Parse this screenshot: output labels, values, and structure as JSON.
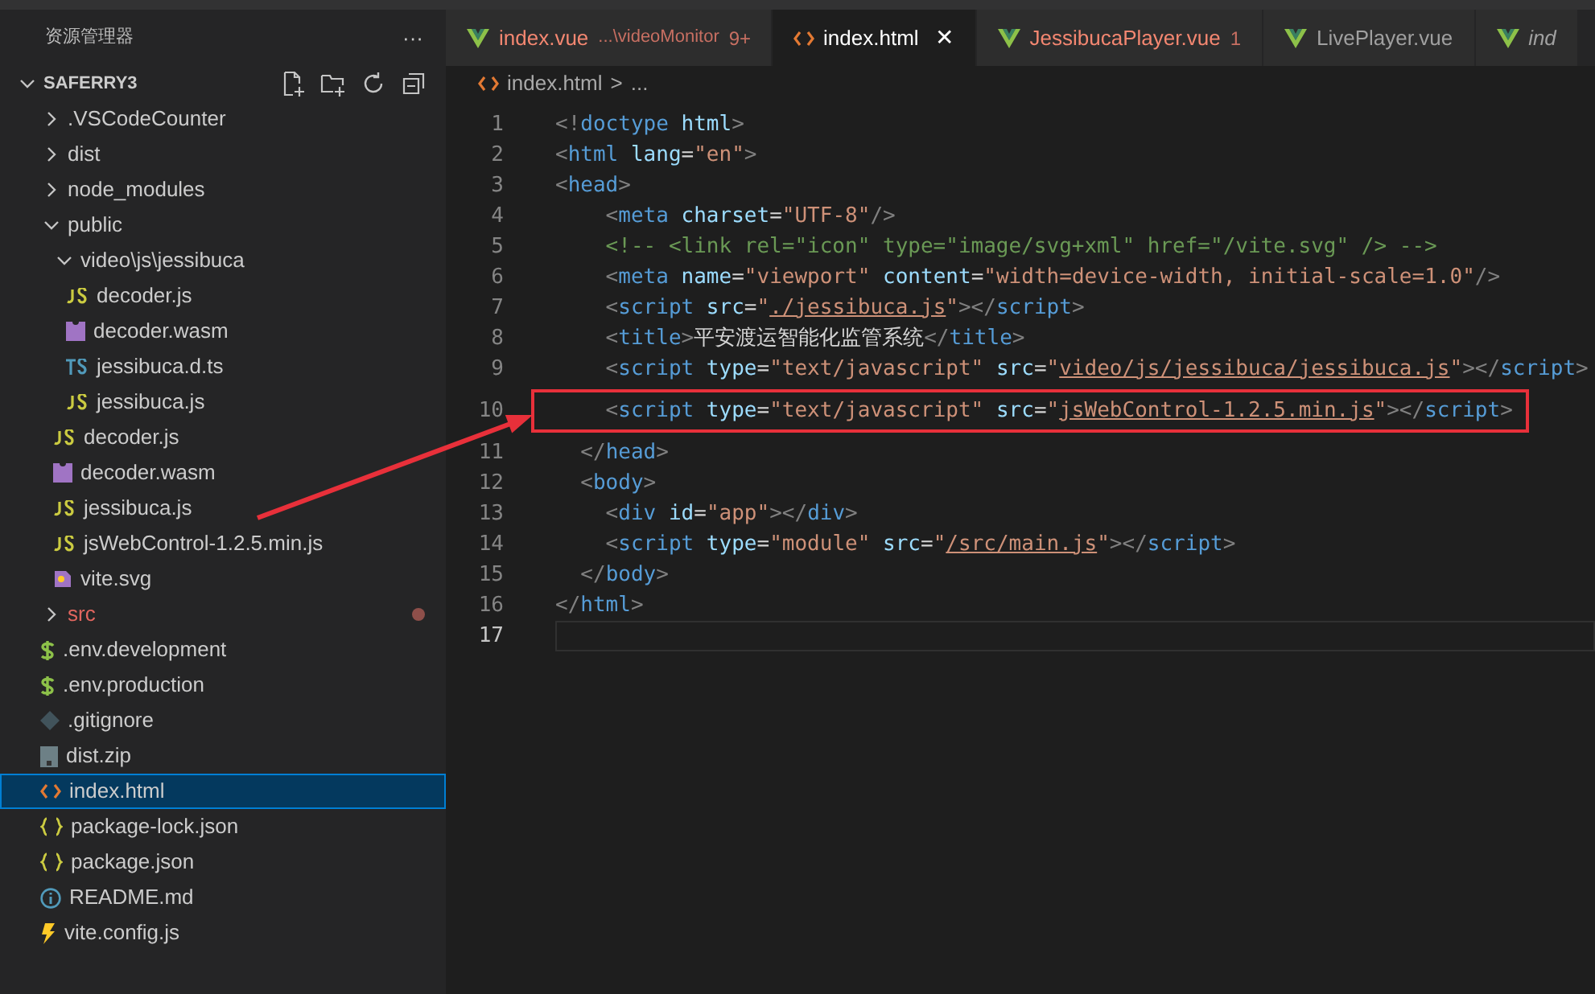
{
  "sidebar": {
    "title": "资源管理器",
    "more": "···",
    "project": {
      "name": "SAFERRY3",
      "expanded": true
    },
    "items": [
      {
        "label": ".VSCodeCounter",
        "kind": "folder",
        "expanded": false,
        "selected": false,
        "modified": false
      },
      {
        "label": "dist",
        "kind": "folder",
        "expanded": false,
        "selected": false,
        "modified": false
      },
      {
        "label": "node_modules",
        "kind": "folder",
        "expanded": false,
        "selected": false,
        "modified": false
      },
      {
        "label": "public",
        "kind": "folder",
        "expanded": true,
        "selected": false,
        "modified": false,
        "children": [
          {
            "label": "video\\js\\jessibuca",
            "kind": "folder",
            "expanded": true,
            "selected": false,
            "modified": false,
            "children": [
              {
                "label": "decoder.js",
                "kind": "js",
                "selected": false,
                "modified": false
              },
              {
                "label": "decoder.wasm",
                "kind": "wasm",
                "selected": false,
                "modified": false
              },
              {
                "label": "jessibuca.d.ts",
                "kind": "ts",
                "selected": false,
                "modified": false
              },
              {
                "label": "jessibuca.js",
                "kind": "js",
                "selected": false,
                "modified": false
              }
            ]
          },
          {
            "label": "decoder.js",
            "kind": "js",
            "selected": false,
            "modified": false
          },
          {
            "label": "decoder.wasm",
            "kind": "wasm",
            "selected": false,
            "modified": false
          },
          {
            "label": "jessibuca.js",
            "kind": "js",
            "selected": false,
            "modified": false
          },
          {
            "label": "jsWebControl-1.2.5.min.js",
            "kind": "js",
            "selected": false,
            "modified": false
          },
          {
            "label": "vite.svg",
            "kind": "svg",
            "selected": false,
            "modified": false
          }
        ]
      },
      {
        "label": "src",
        "kind": "folder",
        "expanded": false,
        "selected": false,
        "modified": true
      },
      {
        "label": ".env.development",
        "kind": "env",
        "selected": false,
        "modified": false
      },
      {
        "label": ".env.production",
        "kind": "env",
        "selected": false,
        "modified": false
      },
      {
        "label": ".gitignore",
        "kind": "git",
        "selected": false,
        "modified": false
      },
      {
        "label": "dist.zip",
        "kind": "zip",
        "selected": false,
        "modified": false
      },
      {
        "label": "index.html",
        "kind": "html",
        "selected": true,
        "modified": false
      },
      {
        "label": "package-lock.json",
        "kind": "json",
        "selected": false,
        "modified": false
      },
      {
        "label": "package.json",
        "kind": "json",
        "selected": false,
        "modified": false
      },
      {
        "label": "README.md",
        "kind": "info",
        "selected": false,
        "modified": false
      },
      {
        "label": "vite.config.js",
        "kind": "vite",
        "selected": false,
        "modified": false
      }
    ]
  },
  "tabs": [
    {
      "label": "index.vue",
      "kind": "vue",
      "description": "...\\videoMonitor",
      "badge": "9+",
      "error": true,
      "italic": false,
      "selected": false
    },
    {
      "label": "index.html",
      "kind": "html",
      "close": "✕",
      "error": false,
      "italic": false,
      "selected": true
    },
    {
      "label": "JessibucaPlayer.vue",
      "kind": "vue",
      "badge": "1",
      "error": true,
      "italic": false,
      "selected": false
    },
    {
      "label": "LivePlayer.vue",
      "kind": "vue",
      "error": false,
      "italic": false,
      "selected": false
    },
    {
      "label": "ind",
      "kind": "vue",
      "error": false,
      "italic": true,
      "selected": false
    }
  ],
  "breadcrumb": {
    "file": "index.html",
    "separator": ">",
    "rest": "..."
  },
  "editor": {
    "lines": [
      {
        "number": "1",
        "highlighted": false,
        "current": false,
        "tokens": [
          {
            "kind": "punct",
            "text": "<!"
          },
          {
            "kind": "tag",
            "text": "doctype"
          },
          {
            "kind": "attr",
            "text": " html"
          },
          {
            "kind": "punct",
            "text": ">"
          }
        ]
      },
      {
        "number": "2",
        "highlighted": false,
        "current": false,
        "tokens": [
          {
            "kind": "punct",
            "text": "<"
          },
          {
            "kind": "tag",
            "text": "html"
          },
          {
            "kind": "attr",
            "text": " lang"
          },
          {
            "kind": "text",
            "text": "="
          },
          {
            "kind": "str",
            "text": "\"en\""
          },
          {
            "kind": "punct",
            "text": ">"
          }
        ]
      },
      {
        "number": "3",
        "highlighted": false,
        "current": false,
        "tokens": [
          {
            "kind": "punct",
            "text": "<"
          },
          {
            "kind": "tag",
            "text": "head"
          },
          {
            "kind": "punct",
            "text": ">"
          }
        ]
      },
      {
        "number": "4",
        "highlighted": false,
        "current": false,
        "tokens": [
          {
            "kind": "punct",
            "text": "    <"
          },
          {
            "kind": "tag",
            "text": "meta"
          },
          {
            "kind": "attr",
            "text": " charset"
          },
          {
            "kind": "text",
            "text": "="
          },
          {
            "kind": "str",
            "text": "\"UTF-8\""
          },
          {
            "kind": "punct",
            "text": "/>"
          }
        ]
      },
      {
        "number": "5",
        "highlighted": false,
        "current": false,
        "tokens": [
          {
            "kind": "comment",
            "text": "    <!-- <link rel=\"icon\" type=\"image/svg+xml\" href=\"/vite.svg\" /> -->"
          }
        ]
      },
      {
        "number": "6",
        "highlighted": false,
        "current": false,
        "tokens": [
          {
            "kind": "punct",
            "text": "    <"
          },
          {
            "kind": "tag",
            "text": "meta"
          },
          {
            "kind": "attr",
            "text": " name"
          },
          {
            "kind": "text",
            "text": "="
          },
          {
            "kind": "str",
            "text": "\"viewport\""
          },
          {
            "kind": "attr",
            "text": " content"
          },
          {
            "kind": "text",
            "text": "="
          },
          {
            "kind": "str",
            "text": "\"width=device-width, initial-scale=1.0\""
          },
          {
            "kind": "punct",
            "text": "/>"
          }
        ]
      },
      {
        "number": "7",
        "highlighted": false,
        "current": false,
        "tokens": [
          {
            "kind": "punct",
            "text": "    <"
          },
          {
            "kind": "tag",
            "text": "script"
          },
          {
            "kind": "attr",
            "text": " src"
          },
          {
            "kind": "text",
            "text": "="
          },
          {
            "kind": "str",
            "text": "\""
          },
          {
            "kind": "link",
            "text": "./jessibuca.js"
          },
          {
            "kind": "str",
            "text": "\""
          },
          {
            "kind": "punct",
            "text": "></"
          },
          {
            "kind": "tag",
            "text": "script"
          },
          {
            "kind": "punct",
            "text": ">"
          }
        ]
      },
      {
        "number": "8",
        "highlighted": false,
        "current": false,
        "tokens": [
          {
            "kind": "punct",
            "text": "    <"
          },
          {
            "kind": "tag",
            "text": "title"
          },
          {
            "kind": "punct",
            "text": ">"
          },
          {
            "kind": "text",
            "text": "平安渡运智能化监管系统"
          },
          {
            "kind": "punct",
            "text": "</"
          },
          {
            "kind": "tag",
            "text": "title"
          },
          {
            "kind": "punct",
            "text": ">"
          }
        ]
      },
      {
        "number": "9",
        "highlighted": false,
        "current": false,
        "tokens": [
          {
            "kind": "punct",
            "text": "    <"
          },
          {
            "kind": "tag",
            "text": "script"
          },
          {
            "kind": "attr",
            "text": " type"
          },
          {
            "kind": "text",
            "text": "="
          },
          {
            "kind": "str",
            "text": "\"text/javascript\""
          },
          {
            "kind": "attr",
            "text": " src"
          },
          {
            "kind": "text",
            "text": "="
          },
          {
            "kind": "str",
            "text": "\""
          },
          {
            "kind": "link",
            "text": "video/js/jessibuca/jessibuca.js"
          },
          {
            "kind": "str",
            "text": "\""
          },
          {
            "kind": "punct",
            "text": "></"
          },
          {
            "kind": "tag",
            "text": "script"
          },
          {
            "kind": "punct",
            "text": ">"
          }
        ]
      },
      {
        "number": "10",
        "highlighted": true,
        "current": false,
        "tokens": [
          {
            "kind": "punct",
            "text": "    <"
          },
          {
            "kind": "tag",
            "text": "script"
          },
          {
            "kind": "attr",
            "text": " type"
          },
          {
            "kind": "text",
            "text": "="
          },
          {
            "kind": "str",
            "text": "\"text/javascript\""
          },
          {
            "kind": "attr",
            "text": " src"
          },
          {
            "kind": "text",
            "text": "="
          },
          {
            "kind": "str",
            "text": "\""
          },
          {
            "kind": "link",
            "text": "jsWebControl-1.2.5.min.js"
          },
          {
            "kind": "str",
            "text": "\""
          },
          {
            "kind": "punct",
            "text": "></"
          },
          {
            "kind": "tag",
            "text": "script"
          },
          {
            "kind": "punct",
            "text": ">"
          }
        ]
      },
      {
        "number": "11",
        "highlighted": false,
        "current": false,
        "tokens": [
          {
            "kind": "punct",
            "text": "  </"
          },
          {
            "kind": "tag",
            "text": "head"
          },
          {
            "kind": "punct",
            "text": ">"
          }
        ]
      },
      {
        "number": "12",
        "highlighted": false,
        "current": false,
        "tokens": [
          {
            "kind": "punct",
            "text": "  <"
          },
          {
            "kind": "tag",
            "text": "body"
          },
          {
            "kind": "punct",
            "text": ">"
          }
        ]
      },
      {
        "number": "13",
        "highlighted": false,
        "current": false,
        "tokens": [
          {
            "kind": "punct",
            "text": "    <"
          },
          {
            "kind": "tag",
            "text": "div"
          },
          {
            "kind": "attr",
            "text": " id"
          },
          {
            "kind": "text",
            "text": "="
          },
          {
            "kind": "str",
            "text": "\"app\""
          },
          {
            "kind": "punct",
            "text": "></"
          },
          {
            "kind": "tag",
            "text": "div"
          },
          {
            "kind": "punct",
            "text": ">"
          }
        ]
      },
      {
        "number": "14",
        "highlighted": false,
        "current": false,
        "tokens": [
          {
            "kind": "punct",
            "text": "    <"
          },
          {
            "kind": "tag",
            "text": "script"
          },
          {
            "kind": "attr",
            "text": " type"
          },
          {
            "kind": "text",
            "text": "="
          },
          {
            "kind": "str",
            "text": "\"module\""
          },
          {
            "kind": "attr",
            "text": " src"
          },
          {
            "kind": "text",
            "text": "="
          },
          {
            "kind": "str",
            "text": "\""
          },
          {
            "kind": "link",
            "text": "/src/main.js"
          },
          {
            "kind": "str",
            "text": "\""
          },
          {
            "kind": "punct",
            "text": "></"
          },
          {
            "kind": "tag",
            "text": "script"
          },
          {
            "kind": "punct",
            "text": ">"
          }
        ]
      },
      {
        "number": "15",
        "highlighted": false,
        "current": false,
        "tokens": [
          {
            "kind": "punct",
            "text": "  </"
          },
          {
            "kind": "tag",
            "text": "body"
          },
          {
            "kind": "punct",
            "text": ">"
          }
        ]
      },
      {
        "number": "16",
        "highlighted": false,
        "current": false,
        "tokens": [
          {
            "kind": "punct",
            "text": "</"
          },
          {
            "kind": "tag",
            "text": "html"
          },
          {
            "kind": "punct",
            "text": ">"
          }
        ]
      },
      {
        "number": "17",
        "highlighted": false,
        "current": true
      }
    ]
  }
}
